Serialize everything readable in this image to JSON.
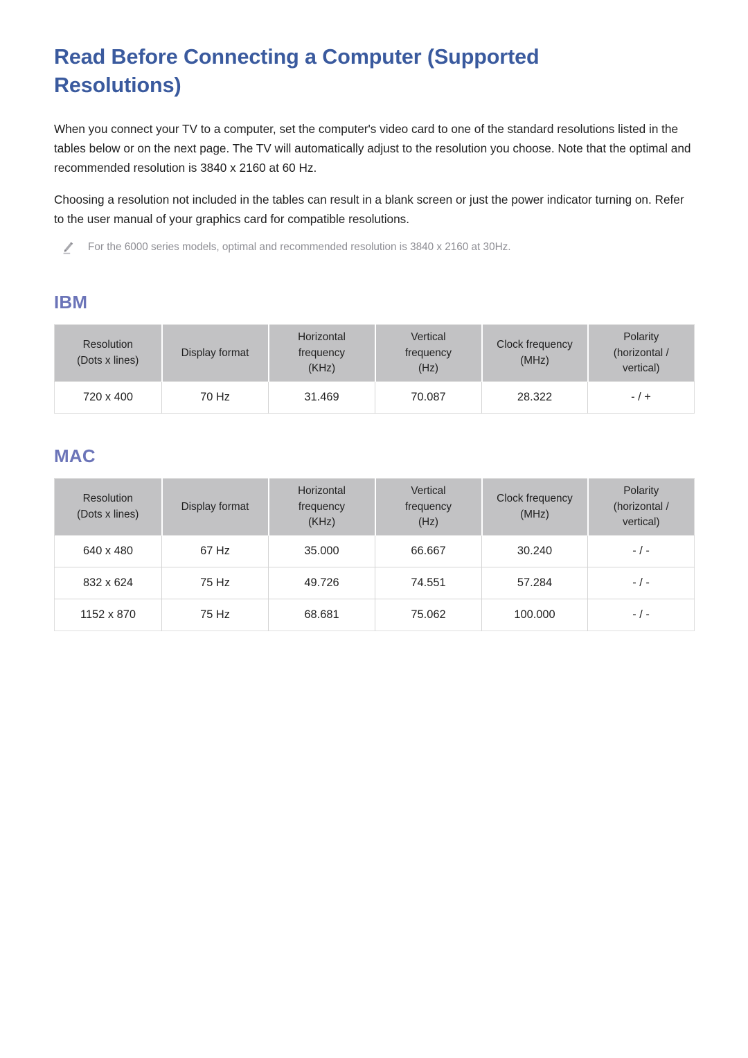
{
  "document": {
    "title": "Read Before Connecting a Computer (Supported Resolutions)",
    "paragraphs": [
      "When you connect your TV to a computer, set the computer's video card to one of the standard resolutions listed in the tables below or on the next page. The TV will automatically adjust to the resolution you choose. Note that the optimal and recommended resolution is 3840 x 2160 at 60 Hz.",
      "Choosing a resolution not included in the tables can result in a blank screen or just the power indicator turning on. Refer to the user manual of your graphics card for compatible resolutions."
    ],
    "note": {
      "icon": "pencil-icon",
      "text": "For the 6000 series models, optimal and recommended resolution is 3840 x 2160 at 30Hz."
    }
  },
  "colors": {
    "title": "#3a5a9e",
    "section_heading": "#6b74b8",
    "table_header_bg": "#c2c2c4",
    "table_border": "#d4d4d4",
    "note_text": "#8d8d93",
    "page_bg": "#ffffff"
  },
  "table_columns": [
    {
      "line1": "Resolution",
      "line2": "(Dots x lines)"
    },
    {
      "line1": "Display format",
      "line2": ""
    },
    {
      "line1": "Horizontal",
      "line2": "frequency",
      "line3": "(KHz)"
    },
    {
      "line1": "Vertical",
      "line2": "frequency",
      "line3": "(Hz)"
    },
    {
      "line1": "Clock frequency",
      "line2": "(MHz)"
    },
    {
      "line1": "Polarity",
      "line2": "(horizontal /",
      "line3": "vertical)"
    }
  ],
  "sections": [
    {
      "heading": "IBM",
      "rows": [
        {
          "resolution": "720 x 400",
          "display_format": "70 Hz",
          "horizontal_frequency": "31.469",
          "vertical_frequency": "70.087",
          "clock_frequency": "28.322",
          "polarity": "- / +"
        }
      ]
    },
    {
      "heading": "MAC",
      "rows": [
        {
          "resolution": "640 x 480",
          "display_format": "67 Hz",
          "horizontal_frequency": "35.000",
          "vertical_frequency": "66.667",
          "clock_frequency": "30.240",
          "polarity": "- / -"
        },
        {
          "resolution": "832 x 624",
          "display_format": "75 Hz",
          "horizontal_frequency": "49.726",
          "vertical_frequency": "74.551",
          "clock_frequency": "57.284",
          "polarity": "- / -"
        },
        {
          "resolution": "1152 x 870",
          "display_format": "75 Hz",
          "horizontal_frequency": "68.681",
          "vertical_frequency": "75.062",
          "clock_frequency": "100.000",
          "polarity": "- / -"
        }
      ]
    }
  ]
}
